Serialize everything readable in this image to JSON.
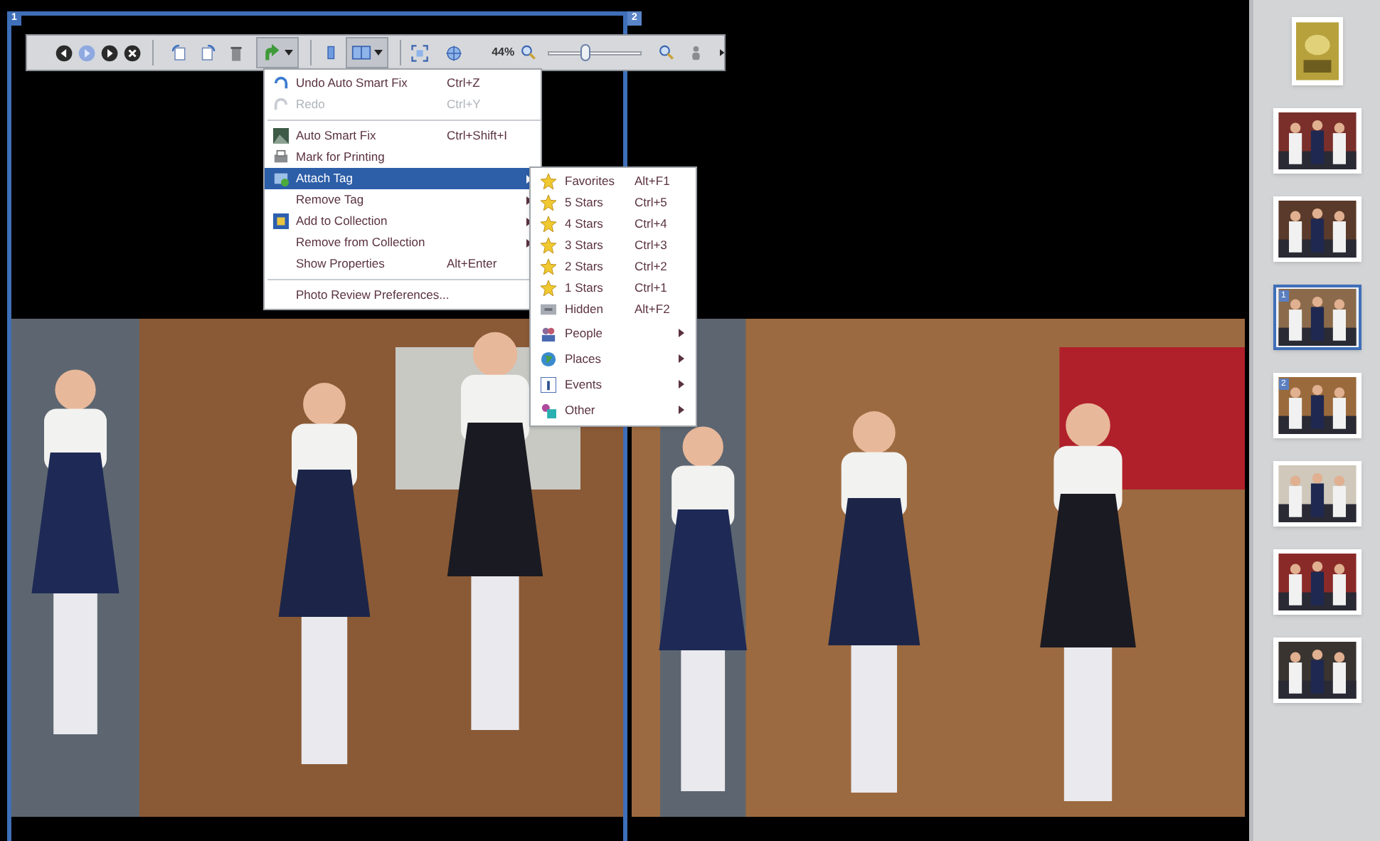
{
  "panes": [
    {
      "label": "1",
      "selected": true
    },
    {
      "label": "2",
      "selected": false
    }
  ],
  "toolbar": {
    "zoom": "44%",
    "zoom_slider": {
      "level": 0.4
    }
  },
  "context_menu": {
    "items": [
      {
        "kind": "item",
        "label": "Undo Auto Smart Fix",
        "shortcut": "Ctrl+Z",
        "disabled": false,
        "selected": false,
        "submenu": false
      },
      {
        "kind": "item",
        "label": "Redo",
        "shortcut": "Ctrl+Y",
        "disabled": true,
        "selected": false,
        "submenu": false
      },
      {
        "kind": "separator"
      },
      {
        "kind": "item",
        "label": "Auto Smart Fix",
        "shortcut": "Ctrl+Shift+I",
        "disabled": false,
        "selected": false,
        "submenu": false
      },
      {
        "kind": "item",
        "label": "Mark for Printing",
        "disabled": false,
        "selected": false,
        "submenu": false
      },
      {
        "kind": "item",
        "label": "Attach Tag",
        "disabled": false,
        "selected": true,
        "submenu": true
      },
      {
        "kind": "item",
        "label": "Remove Tag",
        "disabled": false,
        "selected": false,
        "submenu": true
      },
      {
        "kind": "item",
        "label": "Add to Collection",
        "disabled": false,
        "selected": false,
        "submenu": true
      },
      {
        "kind": "item",
        "label": "Remove from Collection",
        "disabled": false,
        "selected": false,
        "submenu": true
      },
      {
        "kind": "item",
        "label": "Show Properties",
        "shortcut": "Alt+Enter",
        "disabled": false,
        "selected": false,
        "submenu": false
      },
      {
        "kind": "separator"
      },
      {
        "kind": "item",
        "label": "Photo Review Preferences...",
        "disabled": false,
        "selected": false,
        "submenu": false
      }
    ]
  },
  "tag_submenu": {
    "items": [
      {
        "label": "Favorites",
        "shortcut": "Alt+F1",
        "submenu": false
      },
      {
        "label": "5 Stars",
        "shortcut": "Ctrl+5",
        "submenu": false
      },
      {
        "label": "4 Stars",
        "shortcut": "Ctrl+4",
        "submenu": false
      },
      {
        "label": "3 Stars",
        "shortcut": "Ctrl+3",
        "submenu": false
      },
      {
        "label": "2 Stars",
        "shortcut": "Ctrl+2",
        "submenu": false
      },
      {
        "label": "1 Stars",
        "shortcut": "Ctrl+1",
        "submenu": false
      },
      {
        "label": "Hidden",
        "shortcut": "Alt+F2",
        "submenu": false
      },
      {
        "label": "People",
        "submenu": true
      },
      {
        "label": "Places",
        "submenu": true
      },
      {
        "label": "Events",
        "submenu": true
      },
      {
        "label": "Other",
        "submenu": true
      }
    ]
  },
  "filmstrip": {
    "thumbnails": [
      {
        "selected": false
      },
      {
        "selected": false
      },
      {
        "selected": false
      },
      {
        "selected": true,
        "badge": "1"
      },
      {
        "selected": false,
        "badge": "2"
      },
      {
        "selected": false
      },
      {
        "selected": false
      },
      {
        "selected": false
      }
    ]
  }
}
